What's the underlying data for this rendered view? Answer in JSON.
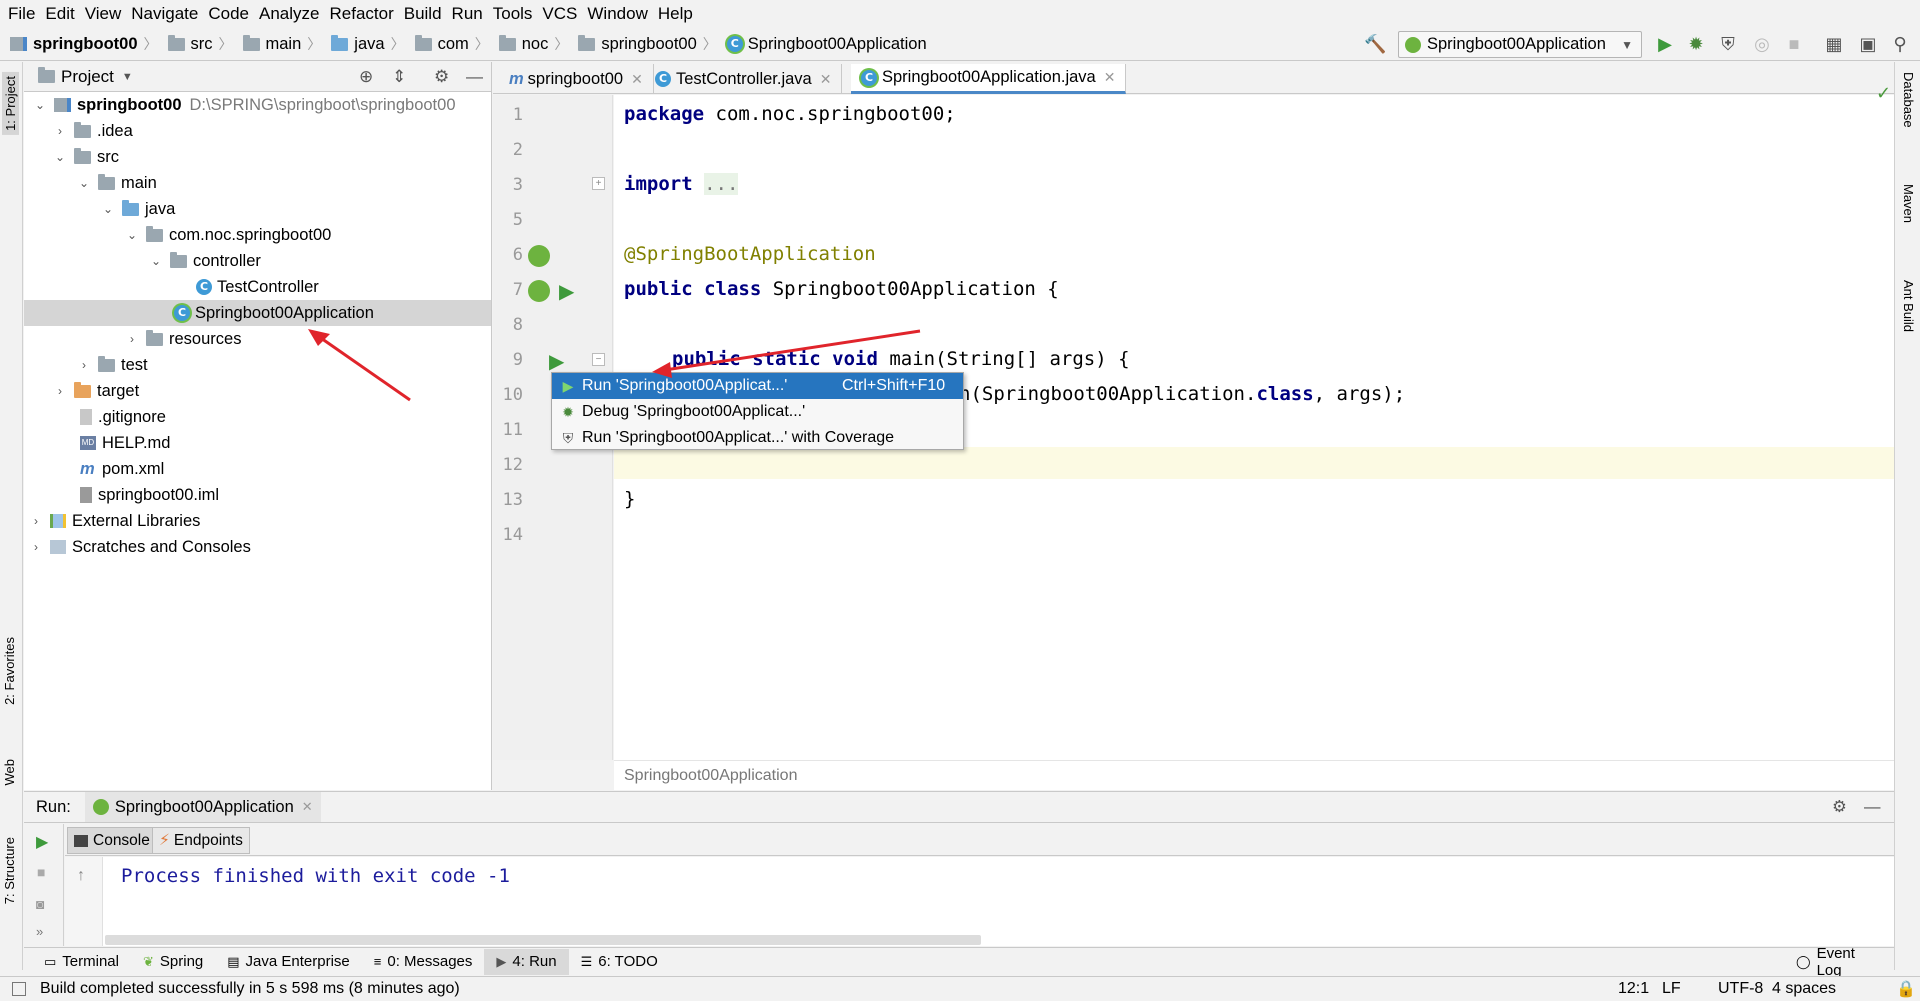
{
  "menu": [
    "File",
    "Edit",
    "View",
    "Navigate",
    "Code",
    "Analyze",
    "Refactor",
    "Build",
    "Run",
    "Tools",
    "VCS",
    "Window",
    "Help"
  ],
  "breadcrumbs": [
    "springboot00",
    "src",
    "main",
    "java",
    "com",
    "noc",
    "springboot00",
    "Springboot00Application"
  ],
  "run_config": {
    "label": "Springboot00Application"
  },
  "project_panel": {
    "title": "Project",
    "tree": [
      {
        "label": "springboot00",
        "extra": "D:\\SPRING\\springboot\\springboot00"
      },
      {
        "label": ".idea"
      },
      {
        "label": "src"
      },
      {
        "label": "main"
      },
      {
        "label": "java"
      },
      {
        "label": "com.noc.springboot00"
      },
      {
        "label": "controller"
      },
      {
        "label": "TestController"
      },
      {
        "label": "Springboot00Application"
      },
      {
        "label": "resources"
      },
      {
        "label": "test"
      },
      {
        "label": "target"
      },
      {
        "label": ".gitignore"
      },
      {
        "label": "HELP.md"
      },
      {
        "label": "pom.xml"
      },
      {
        "label": "springboot00.iml"
      },
      {
        "label": "External Libraries"
      },
      {
        "label": "Scratches and Consoles"
      }
    ]
  },
  "editor_tabs": [
    {
      "label": "springboot00"
    },
    {
      "label": "TestController.java"
    },
    {
      "label": "Springboot00Application.java"
    }
  ],
  "code": {
    "line_numbers": [
      "1",
      "2",
      "3",
      "5",
      "6",
      "7",
      "8",
      "9",
      "10",
      "11",
      "12",
      "13",
      "14"
    ],
    "line1_kw": "package",
    "line1_rest": " com.noc.springboot00;",
    "line3_kw": "import",
    "line3_fold": "...",
    "line6": "@SpringBootApplication",
    "line7_kw": "public class",
    "line7_rest": " Springboot00Application {",
    "line9_kw": "public static void",
    "line9_rest": " main(String[] args) {",
    "line10_prefix": "n",
    "line10_rest": "(Springboot00Application.",
    "line10_kw": "class",
    "line10_end": ", args);",
    "line13": "}"
  },
  "editor_breadcrumb": "Springboot00Application",
  "popup": {
    "items": [
      {
        "label": "Run 'Springboot00Applicat...'",
        "shortcut": "Ctrl+Shift+F10"
      },
      {
        "label": "Debug 'Springboot00Applicat...'"
      },
      {
        "label": "Run 'Springboot00Applicat...' with Coverage"
      }
    ]
  },
  "run_panel": {
    "label": "Run:",
    "tab": "Springboot00Application",
    "subtabs": [
      "Console",
      "Endpoints"
    ],
    "console_text": "Process finished with exit code -1"
  },
  "bottom_tools": [
    {
      "label": "Terminal"
    },
    {
      "label": "Spring"
    },
    {
      "label": "Java Enterprise"
    },
    {
      "label": "0: Messages"
    },
    {
      "label": "4: Run"
    },
    {
      "label": "6: TODO"
    }
  ],
  "event_log": "Event Log",
  "side_tabs": {
    "left": [
      "1: Project",
      "2: Favorites",
      "Web",
      "7: Structure"
    ],
    "right": [
      "Database",
      "Maven",
      "Ant Build"
    ]
  },
  "status": {
    "message": "Build completed successfully in 5 s 598 ms (8 minutes ago)",
    "position": "12:1",
    "line_sep": "LF",
    "encoding": "UTF-8",
    "indent": "4 spaces"
  },
  "colors": {
    "accent": "#2675bf",
    "arrow": "#e0242b",
    "keyword": "#000080",
    "annotation": "#808000"
  }
}
